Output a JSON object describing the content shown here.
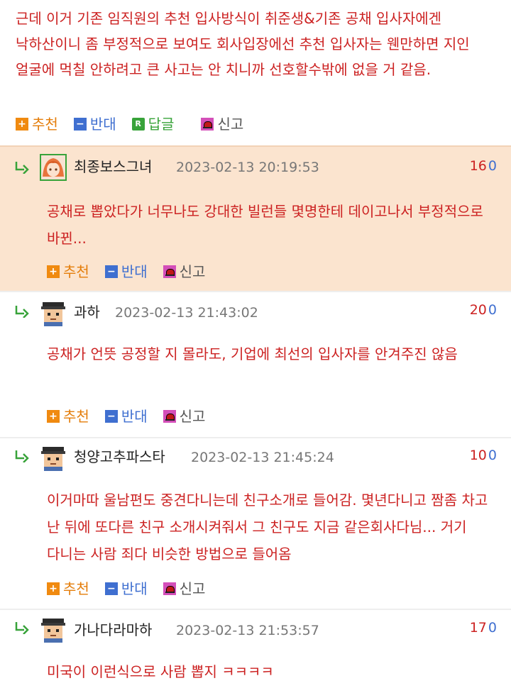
{
  "top_post": {
    "text": "근데 이거 기존 임직원의 추천 입사방식이 취준생&기존 공채 입사자에겐 낙하산이니 좀 부정적으로 보여도 회사입장에선 추천 입사자는 웬만하면 지인 얼굴에 먹칠 안하려고 큰 사고는 안 치니까 선호할수밖에 없을 거 같음.",
    "actions": {
      "upvote": "추천",
      "downvote": "반대",
      "reply": "답글",
      "report": "신고"
    }
  },
  "icons": {
    "upvote": "plus-icon",
    "downvote": "minus-icon",
    "reply": "reply-r-icon",
    "report": "siren-icon",
    "reply_arrow": "reply-arrow-icon"
  },
  "colors": {
    "text_red": "#cc2222",
    "highlight_bg": "#fbe4cf",
    "upvote_orange": "#f08a10",
    "downvote_blue": "#3f6fd0",
    "reply_green": "#38a33a"
  },
  "comments": [
    {
      "nick": "최종보스그녀",
      "timestamp": "2023-02-13 20:19:53",
      "up": "16",
      "down": "0",
      "text": "공채로 뽑았다가 너무나도 강대한 빌런들 몇명한테 데이고나서 부정적으로 바뀐...",
      "actions": {
        "upvote": "추천",
        "downvote": "반대",
        "report": "신고"
      }
    },
    {
      "nick": "과하",
      "timestamp": "2023-02-13 21:43:02",
      "up": "20",
      "down": "0",
      "text": "공채가 언뜻 공정할 지 몰라도, 기업에 최선의 입사자를 안겨주진 않음",
      "actions": {
        "upvote": "추천",
        "downvote": "반대",
        "report": "신고"
      }
    },
    {
      "nick": "청양고추파스타",
      "timestamp": "2023-02-13 21:45:24",
      "up": "10",
      "down": "0",
      "text": "이거마따 울남편도 중견다니는데 친구소개로 들어감. 몇년다니고 짬좀 차고 난 뒤에 또다른 친구 소개시켜줘서 그 친구도 지금 같은회사다님... 거기 다니는 사람 죄다 비슷한 방법으로 들어옴",
      "actions": {
        "upvote": "추천",
        "downvote": "반대",
        "report": "신고"
      }
    },
    {
      "nick": "가나다라마하",
      "timestamp": "2023-02-13 21:53:57",
      "up": "17",
      "down": "0",
      "text": "미국이 이런식으로 사람 뽑지 ㅋㅋㅋㅋ"
    }
  ]
}
